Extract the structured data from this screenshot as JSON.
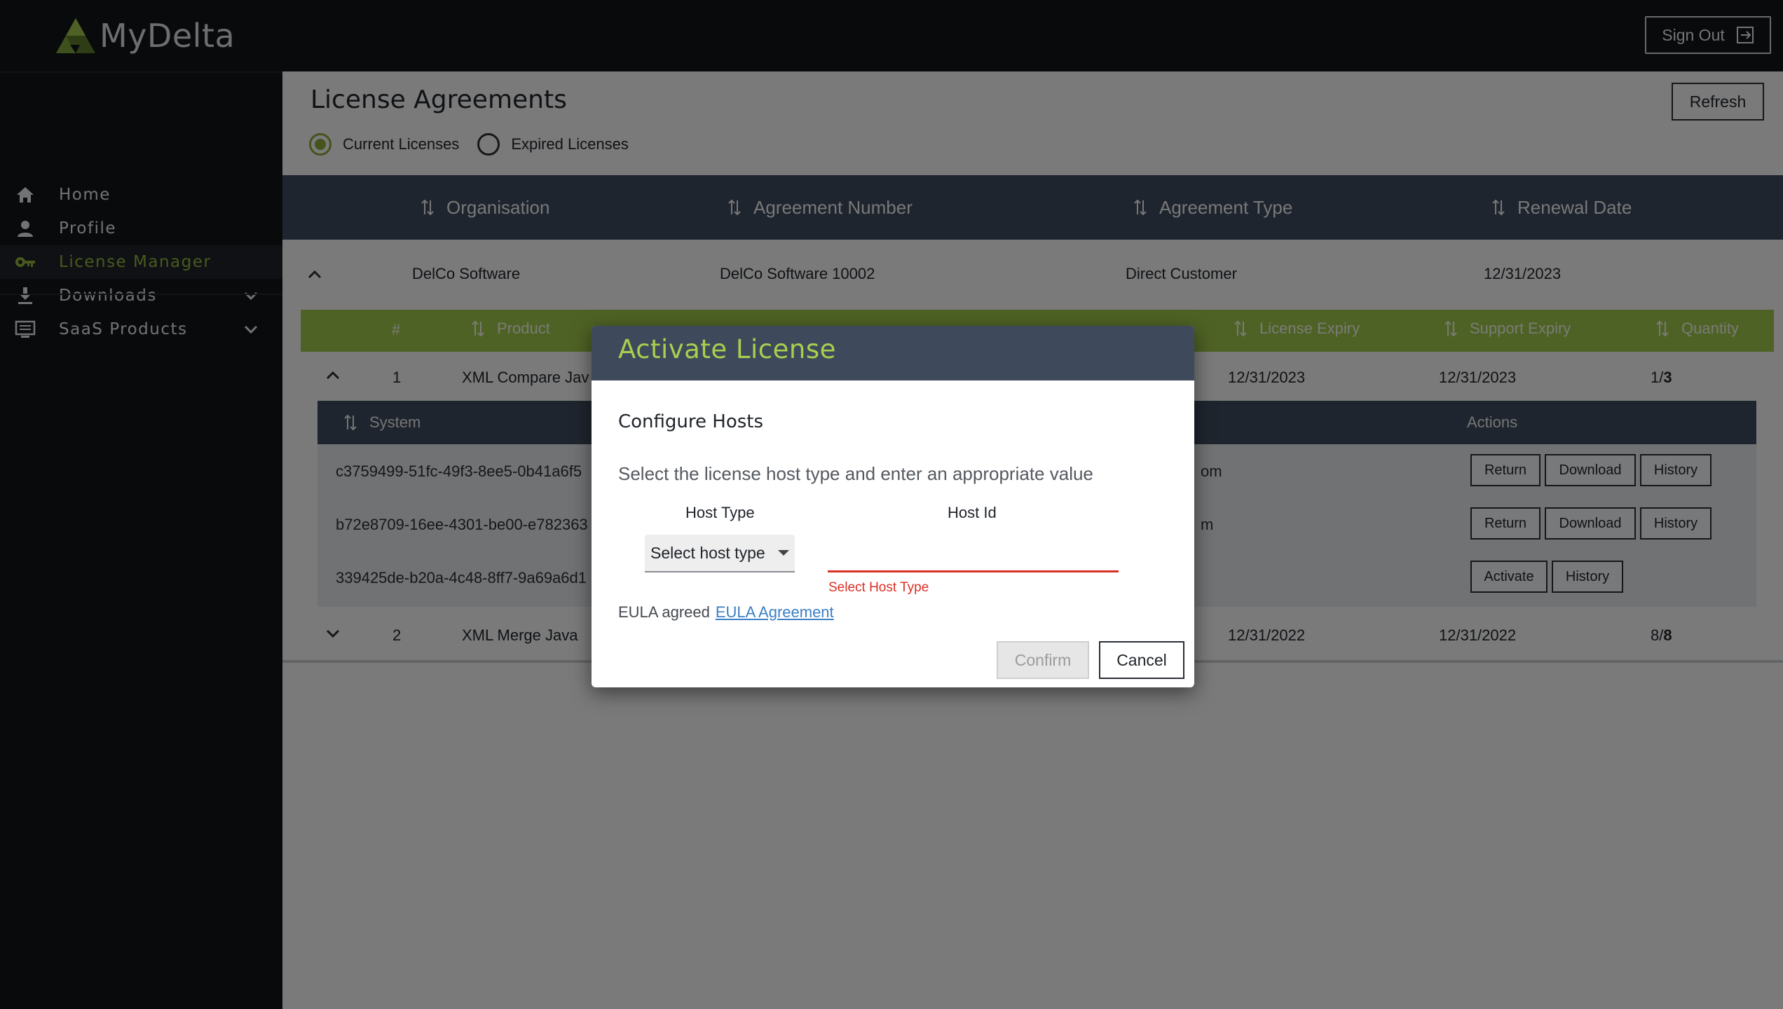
{
  "app": {
    "name": "MyDelta"
  },
  "header": {
    "signout_label": "Sign Out"
  },
  "sidebar": {
    "items": [
      {
        "label": "Home",
        "icon": "home-icon"
      },
      {
        "label": "Profile",
        "icon": "person-icon"
      },
      {
        "label": "License Manager",
        "icon": "key-icon",
        "active": true
      },
      {
        "label": "Downloads",
        "icon": "download-icon",
        "expandable": true
      },
      {
        "label": "SaaS Products",
        "icon": "list-icon",
        "expandable": true
      }
    ]
  },
  "page": {
    "title": "License Agreements",
    "refresh_label": "Refresh",
    "filters": [
      {
        "label": "Current Licenses",
        "selected": true
      },
      {
        "label": "Expired Licenses",
        "selected": false
      }
    ]
  },
  "agreements_table": {
    "columns": [
      "Organisation",
      "Agreement Number",
      "Agreement Type",
      "Renewal Date"
    ],
    "rows": [
      {
        "organisation": "DelCo Software",
        "agreement_number": "DelCo Software 10002",
        "agreement_type": "Direct Customer",
        "renewal_date": "12/31/2023"
      }
    ]
  },
  "products_table": {
    "columns": [
      "#",
      "Product",
      "License Expiry",
      "Support Expiry",
      "Quantity"
    ],
    "rows": [
      {
        "num": "1",
        "product": "XML Compare Jav",
        "license_expiry": "12/31/2023",
        "support_expiry": "12/31/2023",
        "quantity_used": "1/",
        "quantity_total": "3"
      },
      {
        "num": "2",
        "product": "XML Merge Java",
        "license_expiry": "12/31/2022",
        "support_expiry": "12/31/2022",
        "quantity_used": "8/",
        "quantity_total": "8"
      }
    ]
  },
  "systems_table": {
    "columns": [
      "System",
      "Actions"
    ],
    "rows": [
      {
        "system": "c3759499-51fc-49f3-8ee5-0b41a6f5",
        "middle": "om",
        "actions": [
          "Return",
          "Download",
          "History"
        ]
      },
      {
        "system": "b72e8709-16ee-4301-be00-e782363",
        "middle": "m",
        "actions": [
          "Return",
          "Download",
          "History"
        ]
      },
      {
        "system": "339425de-b20a-4c48-8ff7-9a69a6d1",
        "middle": "",
        "actions": [
          "Activate",
          "History"
        ]
      }
    ]
  },
  "modal": {
    "title": "Activate License",
    "subtitle": "Configure Hosts",
    "description": "Select the license host type and enter an appropriate value",
    "host_type_label": "Host Type",
    "host_id_label": "Host Id",
    "select_placeholder": "Select host type",
    "host_id_value": "",
    "error": "Select Host Type",
    "eula_text": "EULA agreed",
    "eula_link": "EULA Agreement",
    "confirm_label": "Confirm",
    "cancel_label": "Cancel"
  },
  "colors": {
    "accent": "#9ec44a",
    "header_bg": "#3e4a5c",
    "dark_bg": "#121519",
    "error": "#d93025"
  }
}
